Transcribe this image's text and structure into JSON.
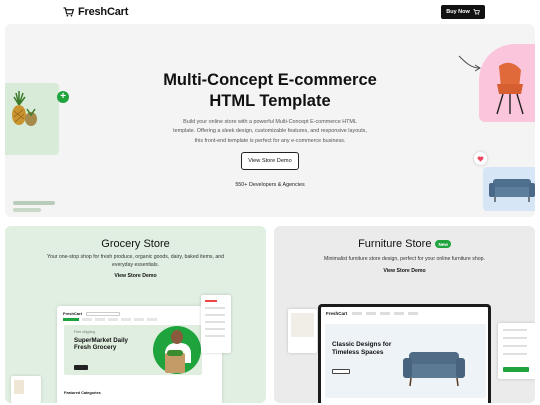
{
  "nav": {
    "brand": "FreshCart",
    "buy_label": "Buy Now"
  },
  "hero": {
    "title_line1": "Multi-Concept E-commerce",
    "title_line2": "HTML Template",
    "description": "Build your online store with a powerful Multi-Concept E-commerce HTML template. Offering a sleek design, customizable features, and responsive layouts, this front-end template is perfect for any e-commerce business.",
    "cta": "View Store Demo",
    "stat": "550+ Developers & Agencies"
  },
  "grocery": {
    "title": "Grocery Store",
    "description": "Your one-stop shop for fresh produce, organic goods, dairy, baked items, and everyday essentials.",
    "cta": "View Store Demo",
    "mock": {
      "logo": "FreshCart",
      "sticker": "Free shipping",
      "headline_line1": "SuperMarket Daily",
      "headline_line2": "Fresh Grocery",
      "featured": "Featured Categories"
    }
  },
  "furniture": {
    "title": "Furniture Store",
    "badge": "New",
    "description": "Minimalist furniture store design, perfect for your online furniture shop.",
    "cta": "View Store Demo",
    "mock": {
      "logo": "FreshCart",
      "headline_line1": "Classic Designs for",
      "headline_line2": "Timeless Spaces"
    }
  },
  "colors": {
    "brand_green": "#1fa33d",
    "dark": "#111111",
    "hero_bg": "#f4f4f4",
    "grocery_bg": "#e0efe1",
    "furniture_bg": "#ebebeb",
    "pink": "#fbc5dc"
  },
  "icons": {
    "brand": "cart-icon",
    "buy": "cart-icon",
    "plus": "plus-icon",
    "heart": "heart-icon"
  }
}
